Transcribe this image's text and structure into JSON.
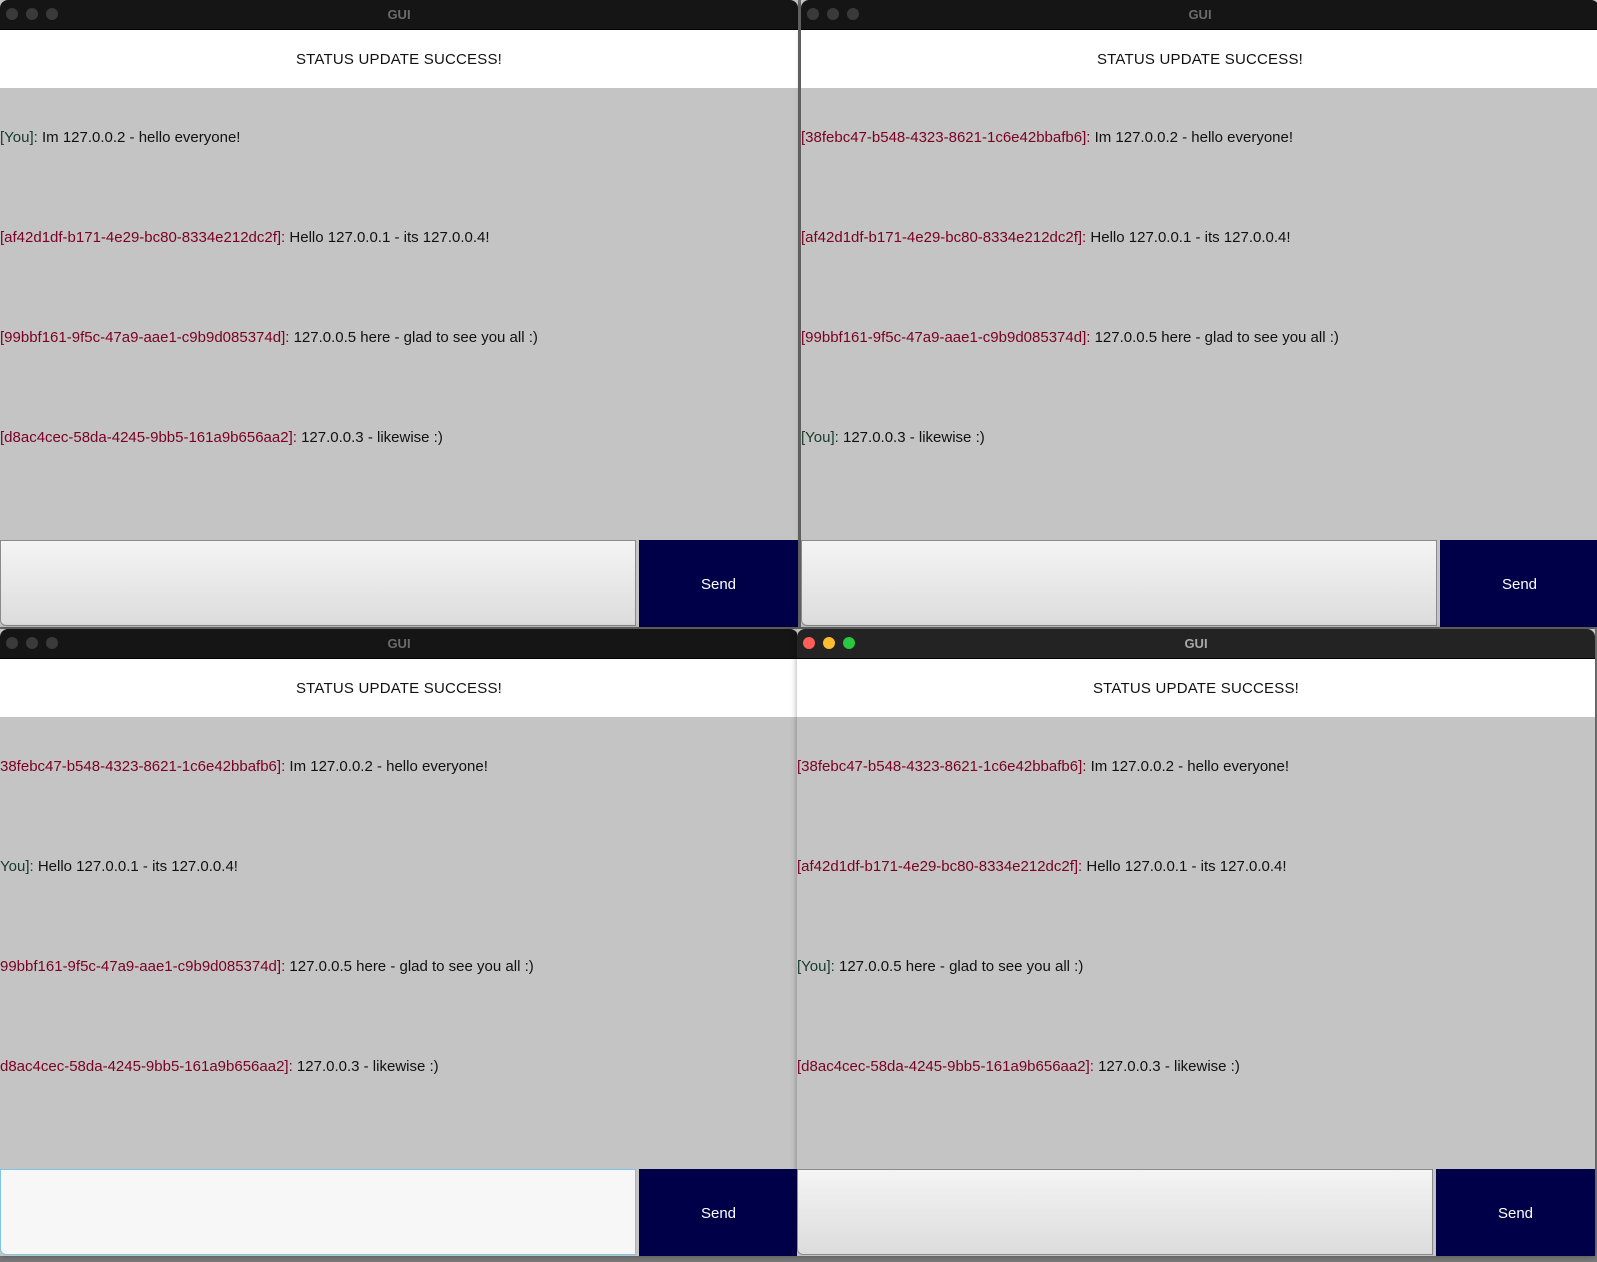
{
  "windows": [
    {
      "title": "GUI",
      "status": "STATUS UPDATE SUCCESS!",
      "messages": [
        {
          "sender": "[You]:",
          "text": "Im 127.0.0.2 - hello everyone!",
          "is_you": true
        },
        {
          "sender": "[af42d1df-b171-4e29-bc80-8334e212dc2f]:",
          "text": "Hello 127.0.0.1 - its 127.0.0.4!",
          "is_you": false
        },
        {
          "sender": "[99bbf161-9f5c-47a9-aae1-c9b9d085374d]:",
          "text": "127.0.0.5 here - glad to see you all :)",
          "is_you": false
        },
        {
          "sender": "[d8ac4cec-58da-4245-9bb5-161a9b656aa2]:",
          "text": "127.0.0.3 - likewise :)",
          "is_you": false
        }
      ],
      "input_value": "",
      "send_label": "Send"
    },
    {
      "title": "GUI",
      "status": "STATUS UPDATE SUCCESS!",
      "messages": [
        {
          "sender": "[38febc47-b548-4323-8621-1c6e42bbafb6]:",
          "text": "Im 127.0.0.2 - hello everyone!",
          "is_you": false
        },
        {
          "sender": "[af42d1df-b171-4e29-bc80-8334e212dc2f]:",
          "text": "Hello 127.0.0.1 - its 127.0.0.4!",
          "is_you": false
        },
        {
          "sender": "[99bbf161-9f5c-47a9-aae1-c9b9d085374d]:",
          "text": "127.0.0.5 here - glad to see you all :)",
          "is_you": false
        },
        {
          "sender": "[You]:",
          "text": "127.0.0.3 - likewise :)",
          "is_you": true
        }
      ],
      "input_value": "",
      "send_label": "Send"
    },
    {
      "title": "GUI",
      "status": "STATUS UPDATE SUCCESS!",
      "messages": [
        {
          "sender": "38febc47-b548-4323-8621-1c6e42bbafb6]:",
          "text": "Im 127.0.0.2 - hello everyone!",
          "is_you": false
        },
        {
          "sender": "You]:",
          "text": "Hello 127.0.0.1 - its 127.0.0.4!",
          "is_you": true
        },
        {
          "sender": "99bbf161-9f5c-47a9-aae1-c9b9d085374d]:",
          "text": "127.0.0.5 here - glad to see you all :)",
          "is_you": false
        },
        {
          "sender": "d8ac4cec-58da-4245-9bb5-161a9b656aa2]:",
          "text": "127.0.0.3 - likewise :)",
          "is_you": false
        }
      ],
      "input_value": "",
      "send_label": "Send"
    },
    {
      "title": "GUI",
      "status": "STATUS UPDATE SUCCESS!",
      "messages": [
        {
          "sender": "[38febc47-b548-4323-8621-1c6e42bbafb6]:",
          "text": "Im 127.0.0.2 - hello everyone!",
          "is_you": false
        },
        {
          "sender": "[af42d1df-b171-4e29-bc80-8334e212dc2f]:",
          "text": "Hello 127.0.0.1 - its 127.0.0.4!",
          "is_you": false
        },
        {
          "sender": "[You]:",
          "text": "127.0.0.5 here - glad to see you all :)",
          "is_you": true
        },
        {
          "sender": "[d8ac4cec-58da-4245-9bb5-161a9b656aa2]:",
          "text": "127.0.0.3 - likewise :)",
          "is_you": false
        }
      ],
      "input_value": "",
      "send_label": "Send"
    }
  ],
  "colors": {
    "sender_other": "#7a0026",
    "sender_you": "#173a2c",
    "send_button_bg": "#000048",
    "chat_background": "#c4c4c4"
  }
}
